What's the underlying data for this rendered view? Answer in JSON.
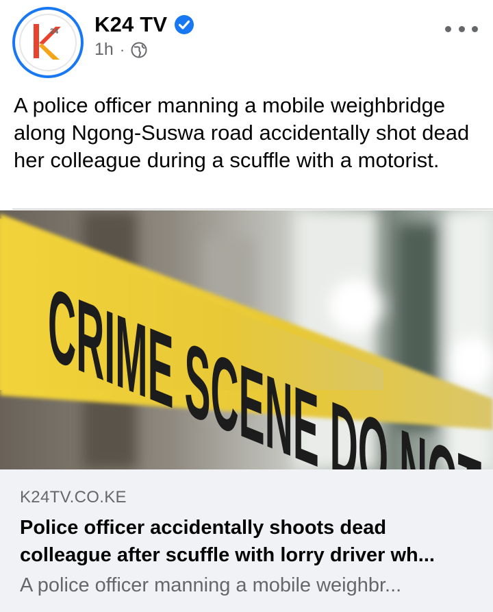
{
  "post": {
    "page_name": "K24 TV",
    "time": "1h",
    "separator": "·",
    "privacy_icon": "globe-icon",
    "verified_icon": "verified-badge-icon",
    "more_icon": "more-options-icon",
    "text": "A police officer manning a mobile weighbridge along Ngong-Suswa road accidentally shot dead her colleague during a scuffle with a motorist."
  },
  "avatar": {
    "logo_text": "K",
    "logo_sup": "24"
  },
  "image": {
    "tape_text": "CRIME SCENE DO NOT CROSS",
    "colors": {
      "tape": "#f2d33a",
      "ink": "#1c1c1c"
    }
  },
  "link_card": {
    "domain": "K24TV.CO.KE",
    "title_line1": "Police officer accidentally shoots dead",
    "title_line2": "colleague after scuffle with lorry driver wh...",
    "description": "A police officer manning a mobile weighbr..."
  },
  "colors": {
    "accent": "#1877f2",
    "secondary_text": "#65676b",
    "card_bg": "#f0f2f5"
  }
}
